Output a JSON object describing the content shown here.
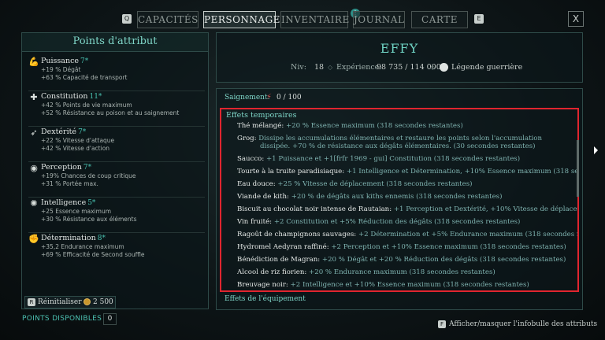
{
  "nav": {
    "key_left": "Q",
    "key_right": "E",
    "tabs": [
      {
        "label": "CAPACITÉS",
        "active": false
      },
      {
        "label": "PERSONNAGE",
        "active": true
      },
      {
        "label": "INVENTAIRE",
        "active": false
      },
      {
        "label": "JOURNAL",
        "active": false
      },
      {
        "label": "CARTE",
        "active": false
      }
    ],
    "journal_badge": "!",
    "close_label": "X"
  },
  "attributes_panel": {
    "title": "Points d'attribut",
    "items": [
      {
        "icon": "strength-icon",
        "name": "Puissance",
        "value": "7*",
        "lines": [
          "+19 % Dégât",
          "+63 % Capacité de transport"
        ]
      },
      {
        "icon": "constitution-icon",
        "name": "Constitution",
        "value": "11*",
        "lines": [
          "+42 % Points de vie maximum",
          "+52 % Résistance au poison et au saignement"
        ]
      },
      {
        "icon": "dexterity-icon",
        "name": "Dextérité",
        "value": "7*",
        "lines": [
          "+22 % Vitesse d'attaque",
          "+42 % Vitesse d'action"
        ]
      },
      {
        "icon": "perception-icon",
        "name": "Perception",
        "value": "7*",
        "lines": [
          "+19% Chances de coup critique",
          "+31 % Portée max."
        ]
      },
      {
        "icon": "intellect-icon",
        "name": "Intelligence",
        "value": "5*",
        "lines": [
          "+25 Essence maximum",
          "+30 % Résistance aux éléments"
        ]
      },
      {
        "icon": "resolve-icon",
        "name": "Détermination",
        "value": "8*",
        "lines": [
          "+35,2 Endurance maximum",
          "+69 % Efficacité de Second souffle"
        ]
      }
    ],
    "reset_key": "R",
    "reset_label": "Réinitialiser",
    "reset_cost": "2 500",
    "available_label": "POINTS DISPONIBLES",
    "available_value": "0"
  },
  "character": {
    "name": "EFFY",
    "level_label": "Niv:",
    "level_value": "18",
    "xp_label": "Expérience:",
    "xp_value": "98 735 / 114 000",
    "title": "Légende guerrière"
  },
  "details": {
    "bleed_label": "Saignement:",
    "bleed_value": "0 / 100",
    "effects_heading": "Effets temporaires",
    "effects": [
      {
        "name": "Thé mélangé:",
        "desc": "+20 % Essence maximum (318 secondes restantes)"
      },
      {
        "name": "Grog:",
        "desc": "Dissipe les accumulations élémentaires et restaure les points selon l'accumulation",
        "desc2": "dissipée. +70 % de résistance aux dégâts élémentaires. (30 secondes restantes)"
      },
      {
        "name": "Saucco:",
        "desc": "+1 Puissance et +1[frfr 1969 - gui] Constitution (318 secondes restantes)"
      },
      {
        "name": "Tourte à la truite paradisiaque:",
        "desc": "+1 Intelligence et Détermination, +10% Essence maximum (318 secondes restan"
      },
      {
        "name": "Eau douce:",
        "desc": "+25 % Vitesse de déplacement (318 secondes restantes)"
      },
      {
        "name": "Viande de kith:",
        "desc": "+20 % de dégâts aux kiths ennemis (318 secondes restantes)"
      },
      {
        "name": "Biscuit au chocolat noir intense de Rautaian:",
        "desc": "+1 Perception et Dextérité, +10% Vitesse de déplacement (318 se"
      },
      {
        "name": "Vin fruité:",
        "desc": "+2 Constitution et +5% Réduction des dégâts (318 secondes restantes)"
      },
      {
        "name": "Ragoût de champignons sauvages:",
        "desc": "+2 Détermination et +5% Endurance maximum (318 secondes restantes)"
      },
      {
        "name": "Hydromel Aedyran raffiné:",
        "desc": "+2 Perception et +10% Essence maximum (318 secondes restantes)"
      },
      {
        "name": "Bénédiction de Magran:",
        "desc": "+20 % Dégât et +20 % Réduction des dégâts (318 secondes restantes)"
      },
      {
        "name": "Alcool de riz fiorien:",
        "desc": "+20 % Endurance maximum (318 secondes restantes)"
      },
      {
        "name": "Breuvage noir:",
        "desc": "+2 Intelligence et +10% Essence maximum (318 secondes restantes)"
      }
    ],
    "equipment_heading": "Effets de l'équipement"
  },
  "footer": {
    "hint_key": "F",
    "hint_label": "Afficher/masquer l'infobulle des attributs"
  },
  "colors": {
    "accent": "#6fd2c3",
    "highlight_border": "#e0252f"
  }
}
